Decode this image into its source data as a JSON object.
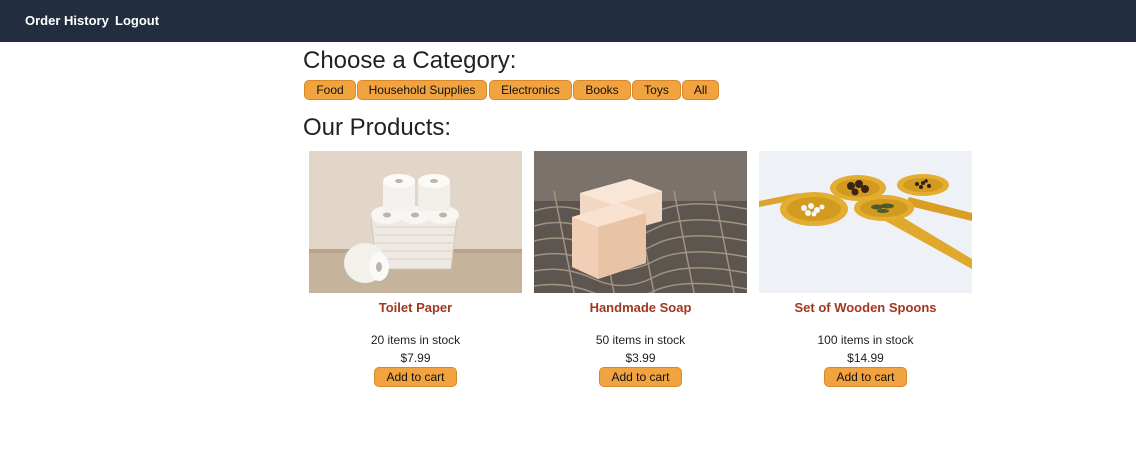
{
  "nav": {
    "order_history": "Order History",
    "logout": "Logout"
  },
  "category_heading": "Choose a Category:",
  "categories": [
    "Food",
    "Household Supplies",
    "Electronics",
    "Books",
    "Toys",
    "All"
  ],
  "products_heading": "Our Products:",
  "products": [
    {
      "name": "Toilet Paper",
      "stock": "20 items in stock",
      "price": "$7.99",
      "button": "Add to cart",
      "image": "toilet-paper-basket"
    },
    {
      "name": "Handmade Soap",
      "stock": "50 items in stock",
      "price": "$3.99",
      "button": "Add to cart",
      "image": "soap-bars-on-net"
    },
    {
      "name": "Set of Wooden Spoons",
      "stock": "100 items in stock",
      "price": "$14.99",
      "button": "Add to cart",
      "image": "wooden-spoons-with-spices"
    }
  ],
  "colors": {
    "navbar": "#222e3f",
    "accent": "#f0a33f",
    "product_name": "#a3361f"
  }
}
